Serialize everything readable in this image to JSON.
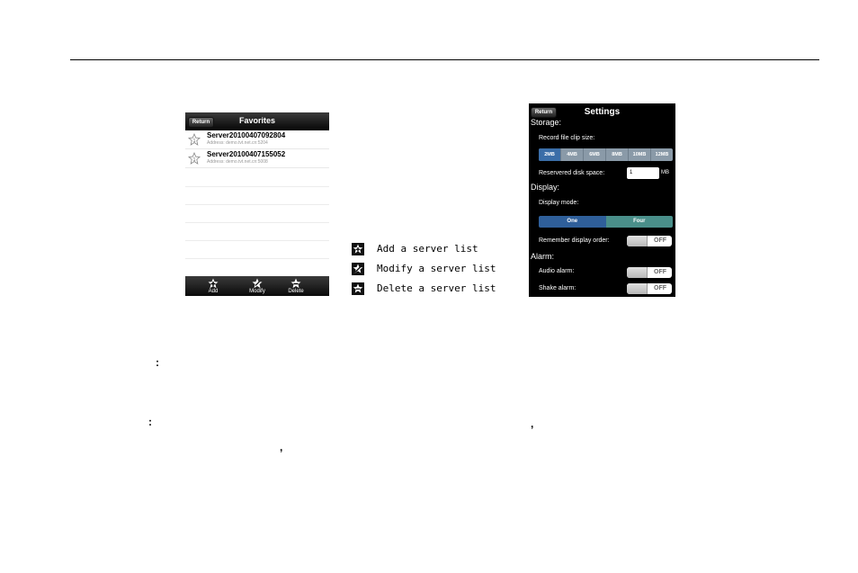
{
  "favorites": {
    "return_label": "Return",
    "title": "Favorites",
    "servers": [
      {
        "name": "Server20100407092804",
        "address": "Address: demo.tvt.net.cn:5204"
      },
      {
        "name": "Server20100407155052",
        "address": "Address: demo.tvt.net.cn:5008"
      }
    ],
    "toolbar": {
      "add": "Add",
      "modify": "Modify",
      "delete": "Delete"
    }
  },
  "legend": [
    {
      "icon": "add-star-icon",
      "label": "Add a server list"
    },
    {
      "icon": "modify-star-icon",
      "label": "Modify a server list"
    },
    {
      "icon": "delete-star-icon",
      "label": "Delete a server list"
    }
  ],
  "settings": {
    "return_label": "Return",
    "title": "Settings",
    "storage_heading": "Storage:",
    "clip_size_label": "Record file clip size:",
    "clip_sizes": [
      "2MB",
      "4MB",
      "6MB",
      "8MB",
      "10MB",
      "12MB"
    ],
    "clip_selected": "2MB",
    "disk_space_label": "Reservered disk space:",
    "disk_space_value": "1",
    "disk_space_unit": "MB",
    "display_heading": "Display:",
    "display_mode_label": "Display mode:",
    "display_modes": [
      "One",
      "Four"
    ],
    "display_selected": "One",
    "remember_label": "Remember display order:",
    "remember_state": "OFF",
    "alarm_heading": "Alarm:",
    "audio_label": "Audio alarm:",
    "audio_state": "OFF",
    "shake_label": "Shake alarm:",
    "shake_state": "OFF"
  },
  "text_marks": {
    "colon1": ":",
    "colon2": ":",
    "comma1": ",",
    "comma2": ","
  }
}
